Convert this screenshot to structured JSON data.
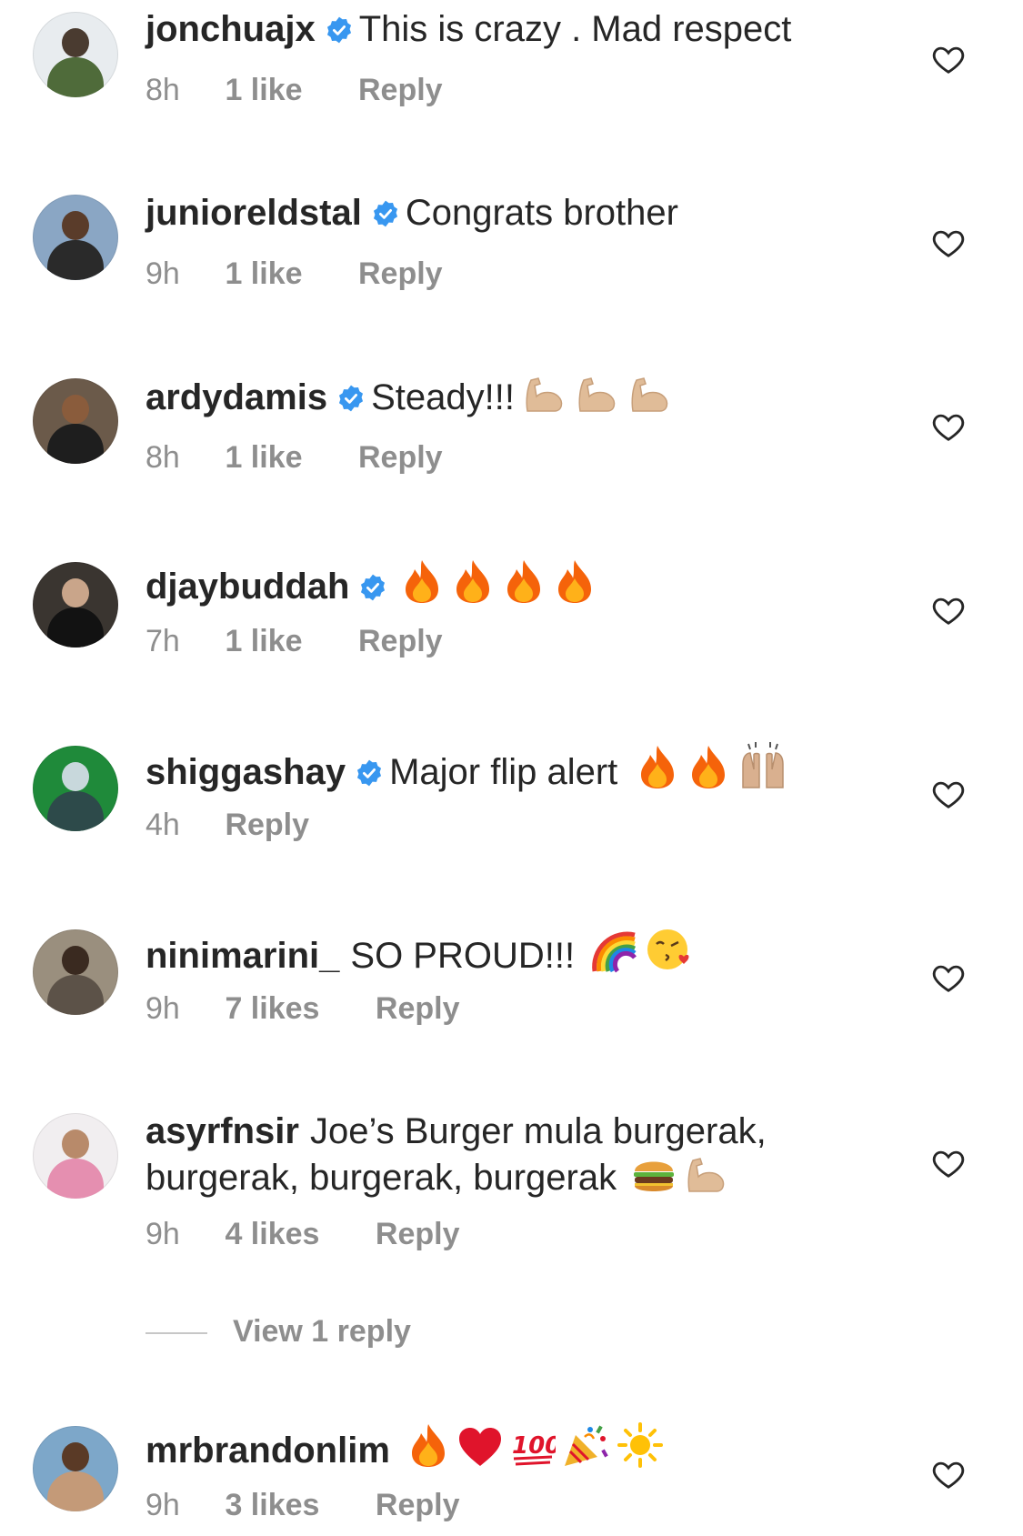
{
  "comments": [
    {
      "username": "jonchuajx",
      "verified": true,
      "text": "This is crazy . Mad respect",
      "time": "8h",
      "likes": "1 like",
      "reply": "Reply",
      "emojis": []
    },
    {
      "username": "junioreldstal",
      "verified": true,
      "text": "Congrats brother",
      "time": "9h",
      "likes": "1 like",
      "reply": "Reply",
      "emojis": []
    },
    {
      "username": "ardydamis",
      "verified": true,
      "text": "Steady!!!",
      "time": "8h",
      "likes": "1 like",
      "reply": "Reply",
      "emojis": [
        "flexed-biceps",
        "flexed-biceps",
        "flexed-biceps"
      ]
    },
    {
      "username": "djaybuddah",
      "verified": true,
      "text": "",
      "time": "7h",
      "likes": "1 like",
      "reply": "Reply",
      "emojis": [
        "fire",
        "fire",
        "fire",
        "fire"
      ]
    },
    {
      "username": "shiggashay",
      "verified": true,
      "text": "Major flip alert",
      "time": "4h",
      "likes": "",
      "reply": "Reply",
      "emojis": [
        "fire",
        "fire",
        "raising-hands"
      ]
    },
    {
      "username": "ninimarini_",
      "verified": false,
      "text": "SO PROUD!!!",
      "time": "9h",
      "likes": "7 likes",
      "reply": "Reply",
      "emojis": [
        "rainbow",
        "kissing-face"
      ]
    },
    {
      "username": "asyrfnsir",
      "verified": false,
      "text": "Joe’s Burger mula burgerak,",
      "text2": "burgerak, burgerak, burgerak",
      "time": "9h",
      "likes": "4 likes",
      "reply": "Reply",
      "emojis2": [
        "hamburger",
        "flexed-biceps"
      ]
    },
    {
      "username": "mrbrandonlim",
      "verified": false,
      "text": "",
      "time": "9h",
      "likes": "3 likes",
      "reply": "Reply",
      "emojis": [
        "fire",
        "red-heart",
        "hundred-points",
        "party-popper",
        "sun"
      ]
    }
  ],
  "view_replies": "View 1 reply",
  "colors": {
    "text": "#262626",
    "secondary": "#8e8e8e",
    "verified": "#3897f0",
    "heart_outline": "#262626"
  }
}
